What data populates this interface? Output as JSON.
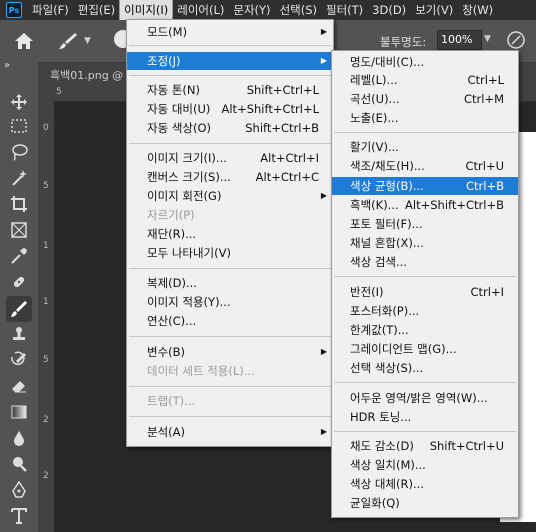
{
  "menubar": {
    "logo": "Ps",
    "items": [
      {
        "label": "파일(F)"
      },
      {
        "label": "편집(E)"
      },
      {
        "label": "이미지(I)"
      },
      {
        "label": "레이어(L)"
      },
      {
        "label": "문자(Y)"
      },
      {
        "label": "선택(S)"
      },
      {
        "label": "필터(T)"
      },
      {
        "label": "3D(D)"
      },
      {
        "label": "보기(V)"
      },
      {
        "label": "창(W)"
      }
    ],
    "active_index": 2
  },
  "options": {
    "opacity_label": "불투명도:",
    "opacity_value": "100%"
  },
  "document": {
    "tab_label": "흑백01.png @",
    "panel_toggle": "»",
    "ruler_top_mark": "5",
    "ruler_left_marks": [
      "0",
      "5",
      "1",
      "1",
      "5",
      "2",
      "2"
    ]
  },
  "image_menu": {
    "items": [
      {
        "label": "모드(M)",
        "shortcut": "",
        "submenu": true,
        "disabled": false
      },
      {
        "label": "조정(J)",
        "shortcut": "",
        "submenu": true,
        "disabled": false,
        "highlight": true
      },
      {
        "label": "자동 톤(N)",
        "shortcut": "Shift+Ctrl+L",
        "disabled": false
      },
      {
        "label": "자동 대비(U)",
        "shortcut": "Alt+Shift+Ctrl+L",
        "disabled": false
      },
      {
        "label": "자동 색상(O)",
        "shortcut": "Shift+Ctrl+B",
        "disabled": false
      },
      {
        "label": "이미지 크기(I)...",
        "shortcut": "Alt+Ctrl+I",
        "disabled": false
      },
      {
        "label": "캔버스 크기(S)...",
        "shortcut": "Alt+Ctrl+C",
        "disabled": false
      },
      {
        "label": "이미지 회전(G)",
        "shortcut": "",
        "submenu": true,
        "disabled": false
      },
      {
        "label": "자르기(P)",
        "shortcut": "",
        "disabled": true
      },
      {
        "label": "재단(R)...",
        "shortcut": "",
        "disabled": false
      },
      {
        "label": "모두 나타내기(V)",
        "shortcut": "",
        "disabled": false
      },
      {
        "label": "복제(D)...",
        "shortcut": "",
        "disabled": false
      },
      {
        "label": "이미지 적용(Y)...",
        "shortcut": "",
        "disabled": false
      },
      {
        "label": "연산(C)...",
        "shortcut": "",
        "disabled": false
      },
      {
        "label": "변수(B)",
        "shortcut": "",
        "submenu": true,
        "disabled": false
      },
      {
        "label": "데이터 세트 적용(L)...",
        "shortcut": "",
        "disabled": true
      },
      {
        "label": "트랩(T)...",
        "shortcut": "",
        "disabled": true
      },
      {
        "label": "분석(A)",
        "shortcut": "",
        "submenu": true,
        "disabled": false
      }
    ]
  },
  "adjust_menu": {
    "items": [
      {
        "label": "명도/대비(C)...",
        "shortcut": ""
      },
      {
        "label": "레벨(L)...",
        "shortcut": "Ctrl+L"
      },
      {
        "label": "곡선(U)...",
        "shortcut": "Ctrl+M"
      },
      {
        "label": "노출(E)...",
        "shortcut": ""
      },
      {
        "label": "활기(V)...",
        "shortcut": ""
      },
      {
        "label": "색조/채도(H)...",
        "shortcut": "Ctrl+U"
      },
      {
        "label": "색상 균형(B)...",
        "shortcut": "Ctrl+B",
        "highlight": true
      },
      {
        "label": "흑백(K)...",
        "shortcut": "Alt+Shift+Ctrl+B"
      },
      {
        "label": "포토 필터(F)...",
        "shortcut": ""
      },
      {
        "label": "채널 혼합(X)...",
        "shortcut": ""
      },
      {
        "label": "색상 검색...",
        "shortcut": ""
      },
      {
        "label": "반전(I)",
        "shortcut": "Ctrl+I"
      },
      {
        "label": "포스터화(P)...",
        "shortcut": ""
      },
      {
        "label": "한계값(T)...",
        "shortcut": ""
      },
      {
        "label": "그레이디언트 맵(G)...",
        "shortcut": ""
      },
      {
        "label": "선택 색상(S)...",
        "shortcut": ""
      },
      {
        "label": "어두운 영역/밝은 영역(W)...",
        "shortcut": ""
      },
      {
        "label": "HDR 토닝...",
        "shortcut": ""
      },
      {
        "label": "채도 감소(D)",
        "shortcut": "Shift+Ctrl+U"
      },
      {
        "label": "색상 일치(M)...",
        "shortcut": ""
      },
      {
        "label": "색상 대체(R)...",
        "shortcut": ""
      },
      {
        "label": "균일화(Q)",
        "shortcut": ""
      }
    ]
  },
  "colors": {
    "highlight": "#1e7bd6",
    "menubar_bg": "#2f2f2f",
    "menu_bg": "#f0f0f0"
  },
  "tools": [
    "move-icon",
    "marquee-icon",
    "lasso-icon",
    "magic-wand-icon",
    "crop-icon",
    "frame-icon",
    "eyedropper-icon",
    "healing-brush-icon",
    "brush-icon",
    "clone-stamp-icon",
    "history-brush-icon",
    "eraser-icon",
    "gradient-icon",
    "blur-icon",
    "dodge-icon",
    "pen-icon",
    "type-icon"
  ]
}
